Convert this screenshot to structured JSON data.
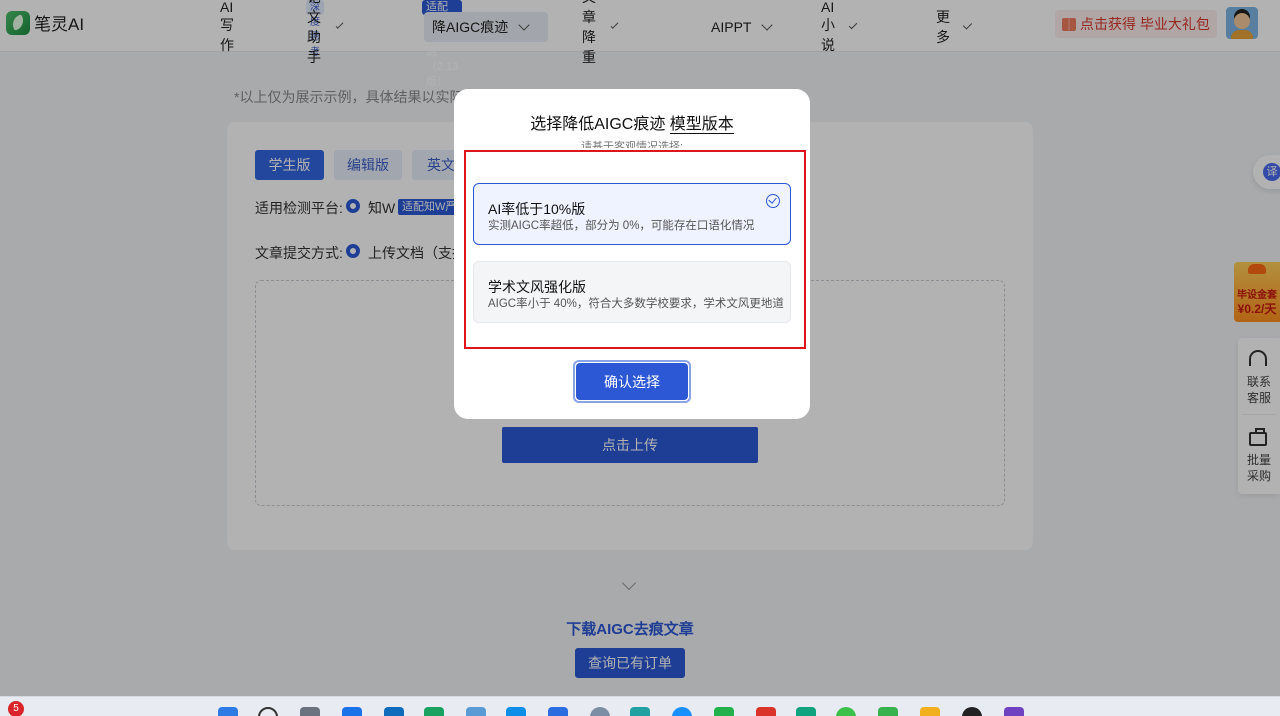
{
  "header": {
    "logo_text": "笔灵AI",
    "nav": [
      {
        "label": "AI写作",
        "has_dropdown": false
      },
      {
        "label": "论文助手",
        "has_dropdown": true,
        "badge": "深度思考"
      },
      {
        "label": "降AIGC痕迹",
        "has_dropdown": true,
        "badge": "适配知W严苛检测（2.13版）",
        "active": true
      },
      {
        "label": "文章降重",
        "has_dropdown": true
      },
      {
        "label": "AIPPT",
        "has_dropdown": true
      },
      {
        "label": "AI小说",
        "has_dropdown": true
      },
      {
        "label": "更多",
        "has_dropdown": true
      }
    ],
    "promo_label": "点击获得 毕业大礼包",
    "avatar_icon": "user-avatar"
  },
  "page": {
    "note": "*以上仅为展示示例，具体结果以实际为",
    "tabs": [
      "学生版",
      "编辑版",
      "英文"
    ],
    "platform_label": "适用检测平台:",
    "platform_value": "知W",
    "platform_chip": "适配知W严",
    "submit_label": "文章提交方式:",
    "submit_value": "上传文档（支持",
    "upload_button": "点击上传",
    "download_title": "下载AIGC去痕文章",
    "query_button": "查询已有订单"
  },
  "side": {
    "translate_label": "译",
    "gift_line1": "毕设金套",
    "gift_line2": "¥0.2/天",
    "service_label": [
      "联系",
      "客服"
    ],
    "bulk_label": [
      "批量",
      "采购"
    ]
  },
  "modal": {
    "title_prefix": "选择降低AIGC痕迹",
    "title_emphasis": "模型版本",
    "subtitle": "请基于客观情况选择:",
    "options": [
      {
        "title": "AI率低于10%版",
        "desc": "实测AIGC率超低，部分为 0%，可能存在口语化情况",
        "selected": true
      },
      {
        "title": "学术文风强化版",
        "desc": "AIGC率小于 40%，符合大多数学校要求，学术文风更地道",
        "selected": false
      }
    ],
    "confirm_button": "确认选择"
  },
  "taskbar": {
    "notification_count": "5"
  },
  "colors": {
    "accent": "#2c58d6",
    "highlight_border": "#e0141d",
    "promo_text": "#d8372b"
  }
}
